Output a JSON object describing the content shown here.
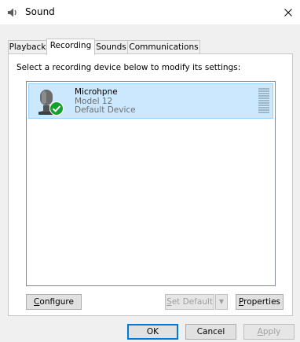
{
  "window": {
    "title": "Sound",
    "icon": "speaker-icon",
    "close_glyph": "✕"
  },
  "tabs": [
    {
      "label": "Playback",
      "active": false
    },
    {
      "label": "Recording",
      "active": true
    },
    {
      "label": "Sounds",
      "active": false
    },
    {
      "label": "Communications",
      "active": false
    }
  ],
  "recording": {
    "instruction": "Select a recording device below to modify its settings:",
    "devices": [
      {
        "name": "Microhpne",
        "model": "Model 12",
        "status": "Default Device",
        "icon": "microphone-icon",
        "badge": "green-check-icon",
        "selected": true
      }
    ]
  },
  "buttons": {
    "configure": {
      "accel": "C",
      "rest": "onfigure"
    },
    "set_default": {
      "accel": "S",
      "rest": "et Default"
    },
    "set_default_arrow": "▼",
    "properties": {
      "accel": "P",
      "rest": "roperties"
    },
    "ok": "OK",
    "cancel": "Cancel",
    "apply": {
      "accel": "A",
      "rest": "pply"
    }
  },
  "colors": {
    "accent": "#0078d7",
    "selection": "#cce8ff",
    "selection_border": "#99d1ff",
    "check_green": "#16a12f"
  }
}
